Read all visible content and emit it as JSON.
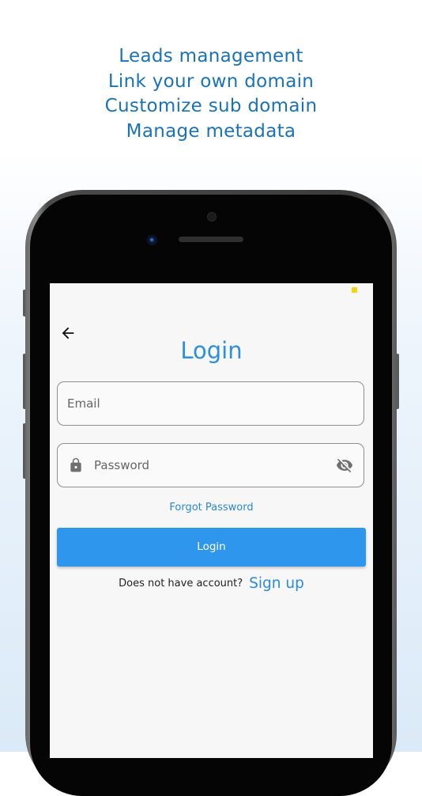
{
  "headline": {
    "lines": [
      "Leads management",
      "Link your own domain",
      "Customize sub domain",
      "Manage metadata"
    ]
  },
  "login_screen": {
    "title": "Login",
    "email_placeholder": "Email",
    "password_placeholder": "Password",
    "forgot_password": "Forgot Password",
    "login_button": "Login",
    "no_account_text": "Does not have account?",
    "signup_link": "Sign up"
  },
  "colors": {
    "headline_text": "#1a73b8",
    "accent": "#2f96ed",
    "title": "#2d8fe0"
  },
  "icons": {
    "back": "arrow-left-icon",
    "lock": "lock-icon",
    "visibility_off": "eye-off-icon"
  }
}
